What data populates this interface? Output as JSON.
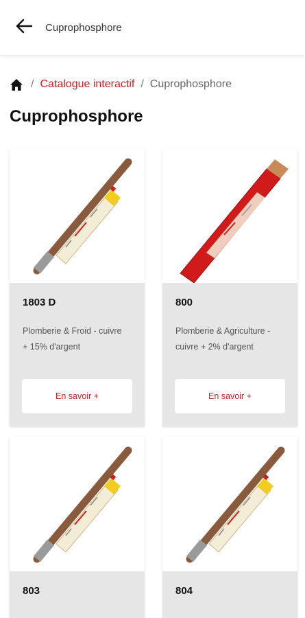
{
  "header": {
    "title": "Cuprophosphore",
    "back_icon": "arrow-left-icon"
  },
  "breadcrumb": {
    "home_icon": "home-icon",
    "separator": "/",
    "link": "Catalogue interactif",
    "current": "Cuprophosphore"
  },
  "page": {
    "title": "Cuprophosphore"
  },
  "colors": {
    "accent": "#cc1f1f",
    "card_bg": "#e6e6e6"
  },
  "products": [
    {
      "name": "1803 D",
      "desc_line1": "Plomberie & Froid - cuivre",
      "desc_line2": "+ 15% d'argent",
      "button": "En savoir +"
    },
    {
      "name": "800",
      "desc_line1": "Plomberie & Agriculture -",
      "desc_line2": "cuivre + 2% d'argent",
      "button": "En savoir +"
    },
    {
      "name": "803",
      "desc_line1": "",
      "desc_line2": "",
      "button": ""
    },
    {
      "name": "804",
      "desc_line1": "",
      "desc_line2": "",
      "button": ""
    }
  ]
}
